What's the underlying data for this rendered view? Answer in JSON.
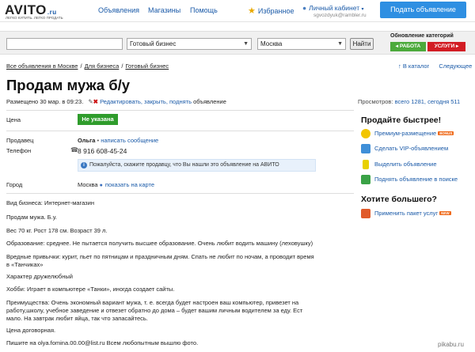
{
  "header": {
    "logo_text": "AVITO",
    "logo_domain": ".ru",
    "logo_tagline": "ЛЕГКО КУПИТЬ. ЛЕГКО ПРОДАТЬ",
    "nav": [
      "Объявления",
      "Магазины",
      "Помощь"
    ],
    "favorites_label": "Избранное",
    "cabinet_label": "Личный кабинет",
    "cabinet_email": "sgvozdyuk@rambler.ru",
    "post_button": "Подать объявление"
  },
  "search": {
    "query_value": "",
    "category_selected": "Готовый бизнес",
    "city_selected": "Москва",
    "submit_label": "Найти",
    "update_title": "Обновление категорий",
    "update_work": "РАБОТА",
    "update_services": "УСЛУГИ"
  },
  "breadcrumbs": [
    "Все объявления в Москве",
    "Для бизнеса",
    "Готовый бизнес"
  ],
  "catnav": {
    "catalog": "В каталог",
    "next": "Следующее"
  },
  "ad": {
    "title": "Продам мужа б/у",
    "posted": "Размещено 30 мар. в 09:23.",
    "edit_link": "Редактировать, закрыть, поднять",
    "edit_suffix": "объявление",
    "views_label": "Просмотров:",
    "views_link": "всего 1281, сегодня 511",
    "price_label": "Цена",
    "price_value": "Не указана",
    "seller_label": "Продавец",
    "seller_name": "Ольга",
    "write_link": "написать сообщение",
    "phone_label": "Телефон",
    "phone_value": "8 916 608-45-24",
    "hint": "Пожалуйста, скажите продавцу, что Вы нашли это объявление на АВИТО",
    "city_label": "Город",
    "city_value": "Москва",
    "map_link": "показать на карте",
    "business_type": "Вид бизнеса: Интернет-магазин",
    "description": [
      "Продам мужа. Б.у.",
      "Вес 70 кг. Рост 178 см. Возраст 39 л.",
      "Образование: среднее. Не пытается получить высшее образование. Очень любит водить машину (леховушку)",
      "Вредные привычки: курит, пьет по пятницам и праздничным дням. Спать не любит по ночам, а проводит время",
      "в «Танчиках»",
      "Характер дружелюбный",
      "Хобби: Играет в компьютере «Танки», иногда создает сайты.",
      "Преимущества: Очень экономный вариант мужа, т. е. всегда будет настроен ваш компьютер, привезет на",
      "работу,школу, учебное заведение и отвезет обратно до дома – будет вашим личным водителем за еду. Ест",
      "мало. На завтрак любит яйца, так что запасайтесь.",
      "Цена договорная.",
      "Пишите на olya.fomina.00.00@list.ru Всем любопытным вышлю фото."
    ]
  },
  "sidebar": {
    "sell_faster": "Продайте быстрее!",
    "items": [
      {
        "label": "Премиум-размещение",
        "badge": "BONUS"
      },
      {
        "label": "Сделать VIP-объявлением",
        "badge": ""
      },
      {
        "label": "Выделить объявление",
        "badge": ""
      },
      {
        "label": "Поднять объявление в поиске",
        "badge": ""
      }
    ],
    "want_more": "Хотите большего?",
    "package": {
      "label": "Применить пакет услуг",
      "badge": "NEW"
    }
  },
  "watermark": "pikabu.ru",
  "colors": {
    "link": "#1a5aa8",
    "post_button": "#2e8fe2",
    "price_badge": "#2f9c2c",
    "work": "#4caa3c",
    "services": "#d21d24"
  },
  "icons": [
    "star-icon",
    "person-icon",
    "pencil-icon",
    "delete-icon",
    "phone-icon",
    "info-icon",
    "map-marker-icon",
    "premium-icon",
    "vip-icon",
    "highlight-icon",
    "lift-icon",
    "package-icon"
  ]
}
